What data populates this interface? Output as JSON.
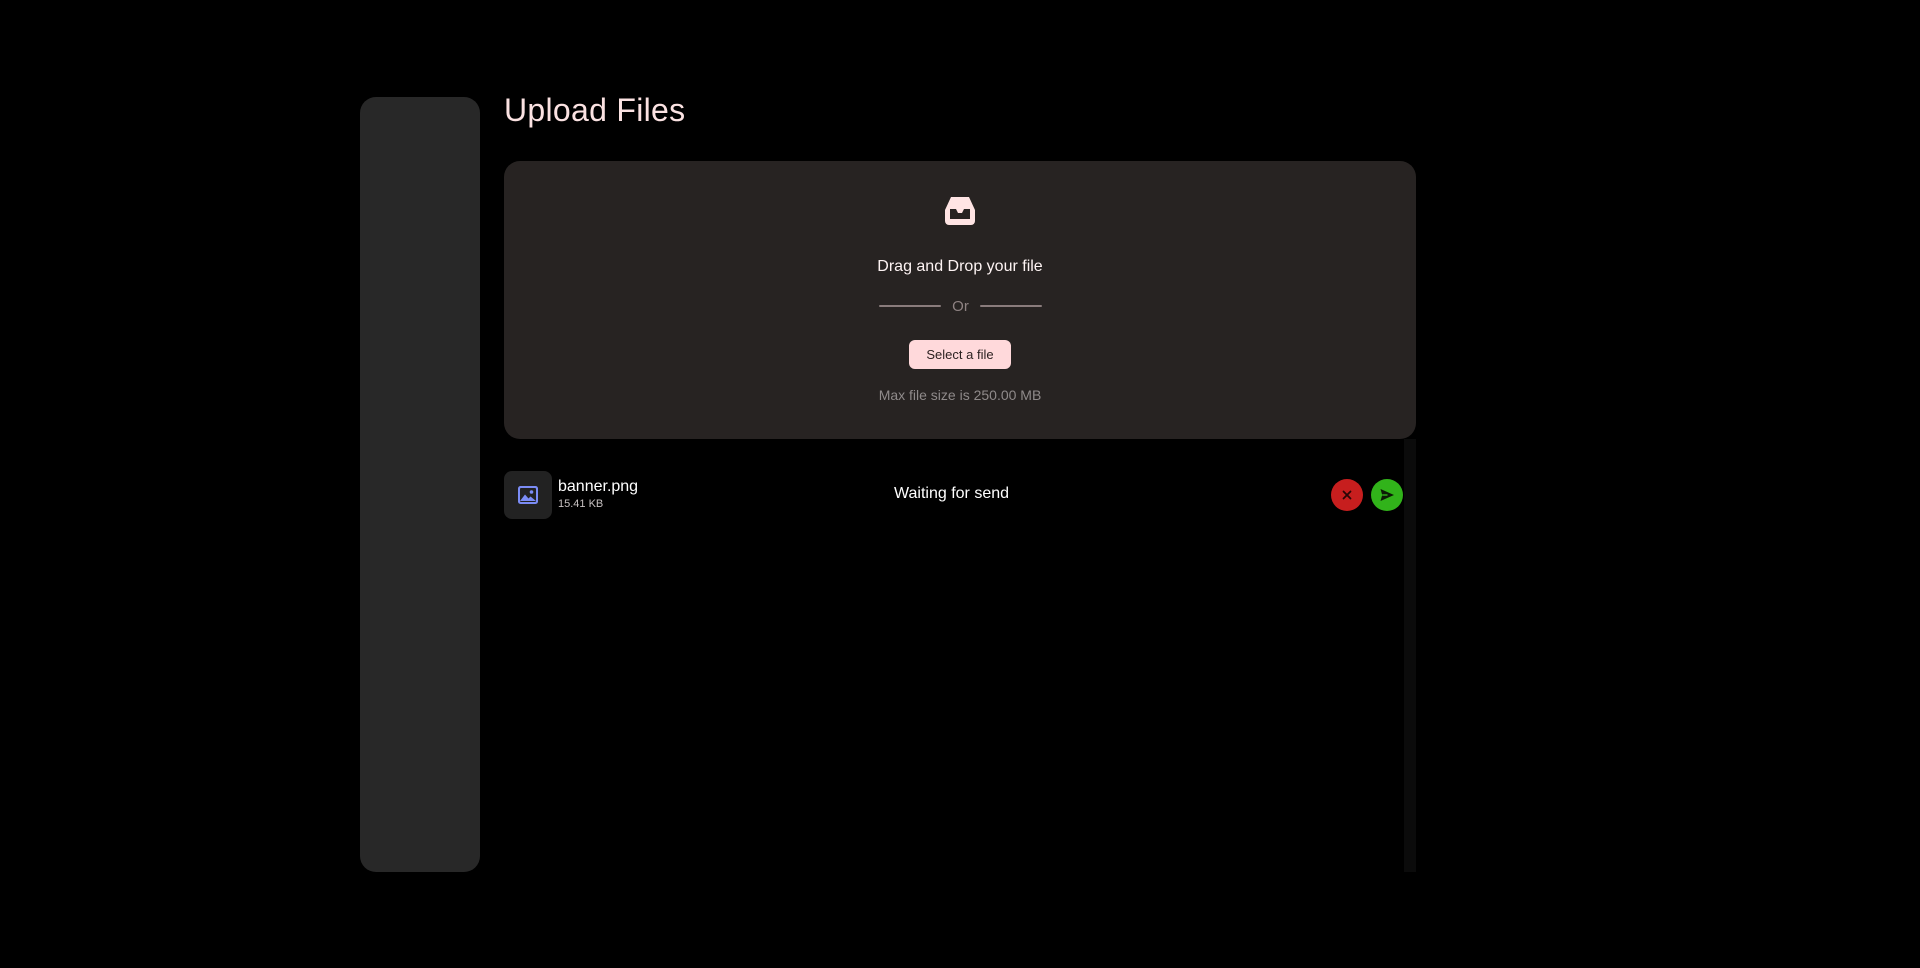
{
  "page": {
    "title": "Upload Files"
  },
  "sidebar": {
    "items": [
      {
        "icon": "transfer-arrows-icon",
        "active": false
      },
      {
        "icon": "cloud-upload-icon",
        "active": true
      },
      {
        "icon": "cloud-download-icon",
        "active": false
      }
    ],
    "bottom_item": {
      "icon": "cloud-off-icon"
    }
  },
  "dropzone": {
    "icon": "inbox-tray-icon",
    "title": "Drag and Drop your file",
    "separator": "Or",
    "select_label": "Select a file",
    "hint": "Max file size is 250.00 MB"
  },
  "files": [
    {
      "icon": "image-icon",
      "name": "banner.png",
      "size": "15.41 KB",
      "status": "Waiting for send"
    }
  ],
  "colors": {
    "background": "#000000",
    "sidebar": "#282828",
    "panel": "#272322",
    "accent": "#ffd9db",
    "title": "#fbe2e2",
    "cancel": "#c71e1e",
    "send": "#31b31a",
    "image_icon": "#7b8cf5"
  }
}
